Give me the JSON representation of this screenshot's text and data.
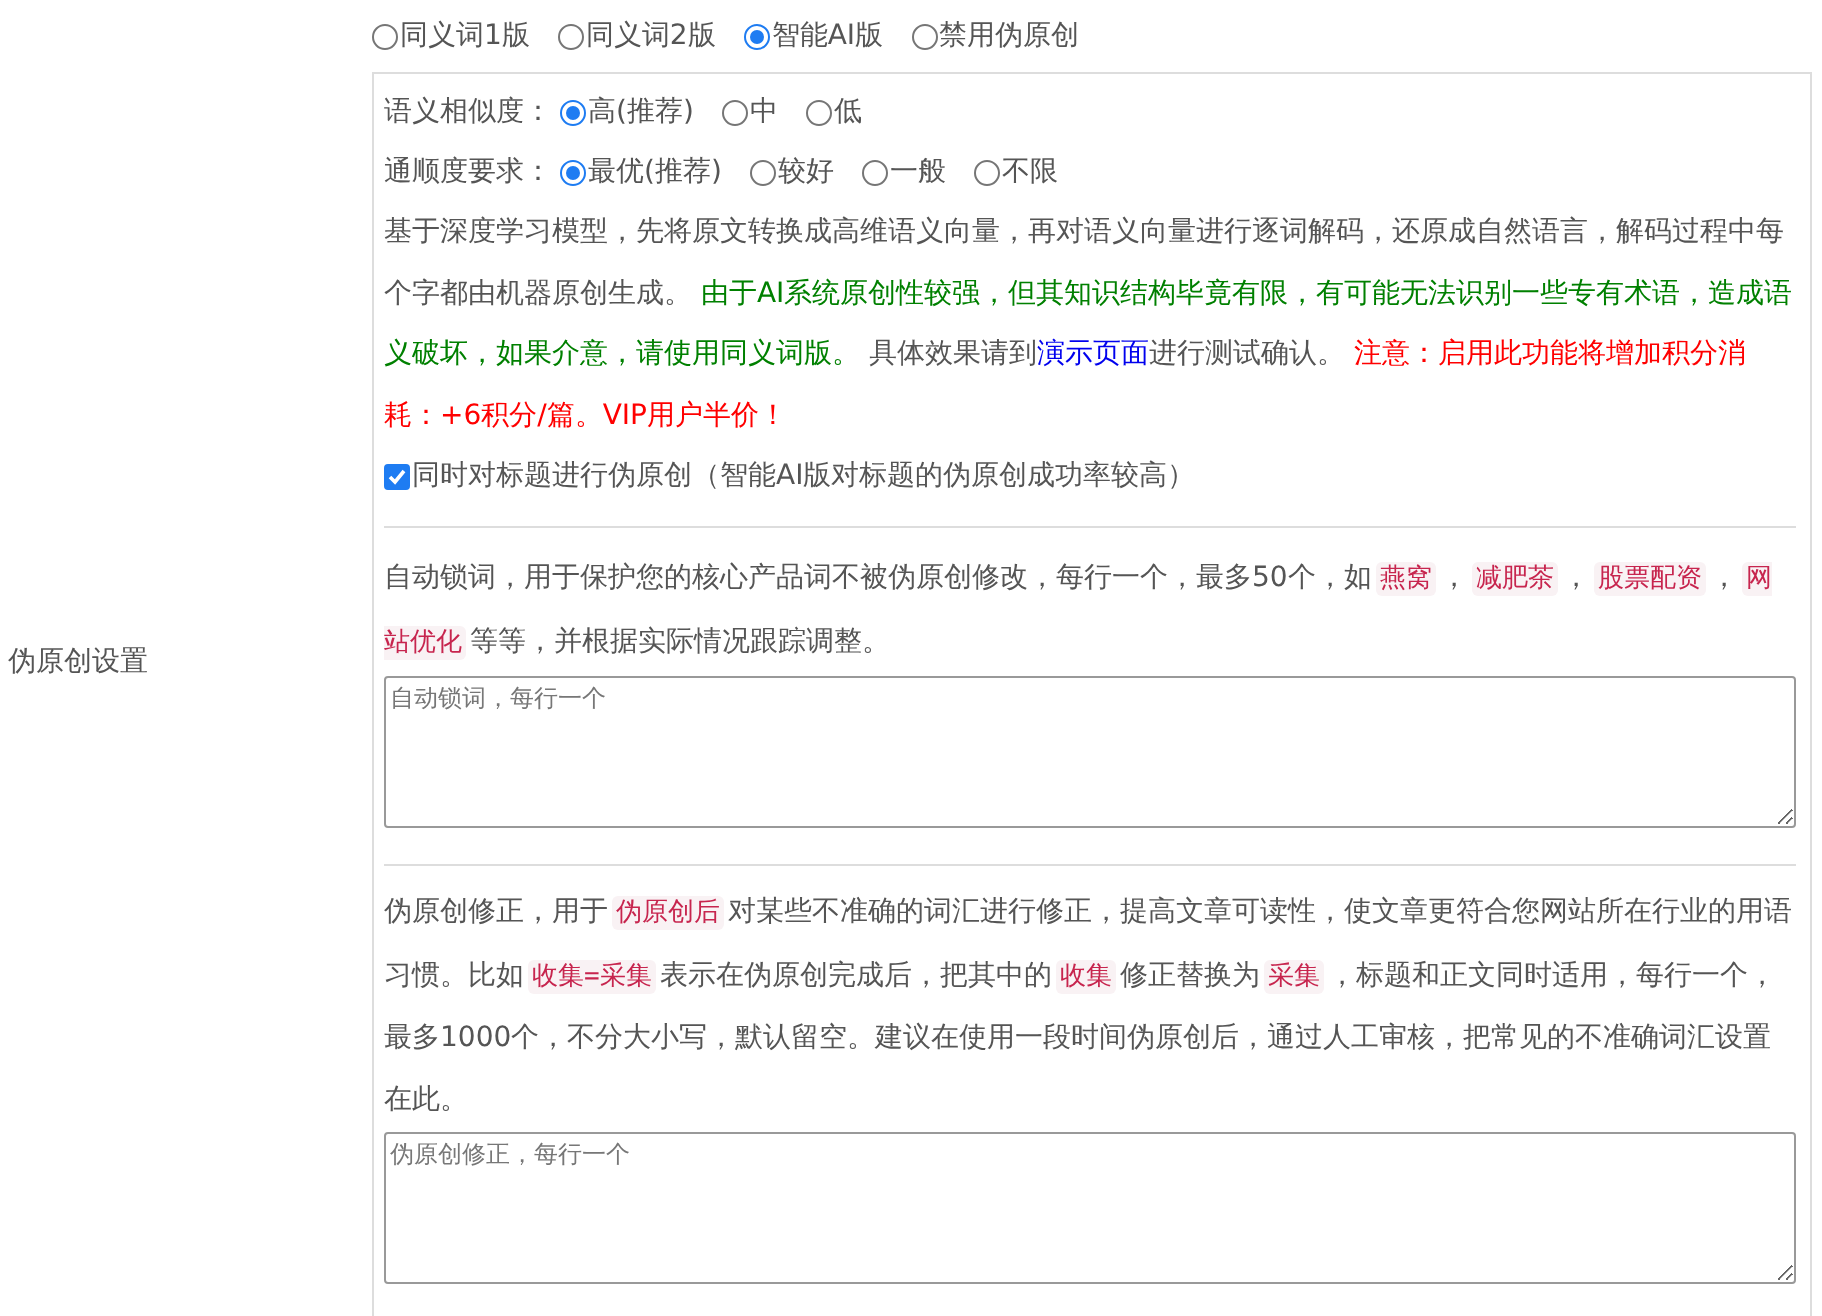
{
  "section_label": "伪原创设置",
  "mode_options": [
    {
      "label": "同义词1版",
      "selected": false
    },
    {
      "label": "同义词2版",
      "selected": false
    },
    {
      "label": "智能AI版",
      "selected": true
    },
    {
      "label": "禁用伪原创",
      "selected": false
    }
  ],
  "similarity": {
    "label": "语义相似度：",
    "options": [
      {
        "label": "高(推荐)",
        "selected": true
      },
      {
        "label": "中",
        "selected": false
      },
      {
        "label": "低",
        "selected": false
      }
    ]
  },
  "fluency": {
    "label": "通顺度要求：",
    "options": [
      {
        "label": "最优(推荐)",
        "selected": true
      },
      {
        "label": "较好",
        "selected": false
      },
      {
        "label": "一般",
        "selected": false
      },
      {
        "label": "不限",
        "selected": false
      }
    ]
  },
  "description": [
    {
      "kind": "text",
      "text": "基于深度学习模型，先将原文转换成高维语义向量，再对语义向量进行逐词解码，还原成自然语言，解码过程中每个字都由机器原创生成。 "
    },
    {
      "kind": "green",
      "text": "由于AI系统原创性较强，但其知识结构毕竟有限，有可能无法识别一些专有术语，造成语义破坏，如果介意，请使用同义词版。"
    },
    {
      "kind": "text",
      "text": " 具体效果请到"
    },
    {
      "kind": "link",
      "text": "演示页面"
    },
    {
      "kind": "text",
      "text": "进行测试确认。 "
    },
    {
      "kind": "red",
      "text": "注意：启用此功能将增加积分消耗：+6积分/篇。VIP用户半价！"
    }
  ],
  "title_option": {
    "label": "同时对标题进行伪原创（智能AI版对标题的伪原创成功率较高）",
    "checked": true
  },
  "lock_words": {
    "description": [
      {
        "kind": "text",
        "text": "自动锁词，用于保护您的核心产品词不被伪原创修改，每行一个，最多50个，如"
      },
      {
        "kind": "tag",
        "text": "燕窝"
      },
      {
        "kind": "text",
        "text": "，"
      },
      {
        "kind": "tag",
        "text": "减肥茶"
      },
      {
        "kind": "text",
        "text": "，"
      },
      {
        "kind": "tag",
        "text": "股票配资"
      },
      {
        "kind": "text",
        "text": "，"
      },
      {
        "kind": "tag",
        "text": "网站优化"
      },
      {
        "kind": "text",
        "text": "等等，并根据实际情况跟踪调整。"
      }
    ],
    "placeholder": "自动锁词，每行一个"
  },
  "corrections": {
    "description": [
      {
        "kind": "text",
        "text": "伪原创修正，用于"
      },
      {
        "kind": "tag",
        "text": "伪原创后"
      },
      {
        "kind": "text",
        "text": "对某些不准确的词汇进行修正，提高文章可读性，使文章更符合您网站所在行业的用语习惯。比如"
      },
      {
        "kind": "tag",
        "text": "收集=采集"
      },
      {
        "kind": "text",
        "text": "表示在伪原创完成后，把其中的"
      },
      {
        "kind": "tag",
        "text": "收集"
      },
      {
        "kind": "text",
        "text": "修正替换为"
      },
      {
        "kind": "tag",
        "text": "采集"
      },
      {
        "kind": "text",
        "text": "，标题和正文同时适用，每行一个，最多1000个，不分大小写，默认留空。建议在使用一段时间伪原创后，通过人工审核，把常见的不准确词汇设置在此。"
      }
    ],
    "placeholder": "伪原创修正，每行一个"
  }
}
